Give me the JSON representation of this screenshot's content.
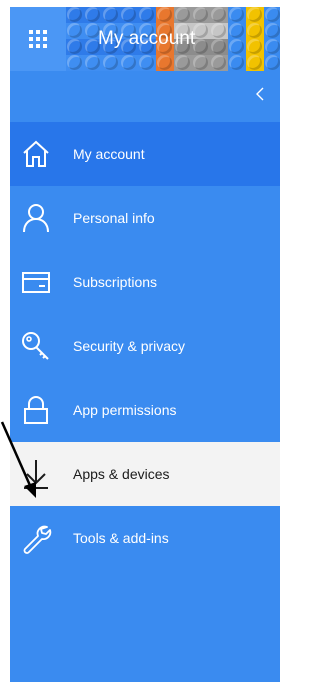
{
  "header": {
    "title": "My account",
    "app_launcher_icon": "waffle-grid-icon"
  },
  "sidebar": {
    "collapse_icon": "chevron-left-icon",
    "items": [
      {
        "label": "My account",
        "icon": "home-icon",
        "state": "current"
      },
      {
        "label": "Personal info",
        "icon": "person-icon",
        "state": "default"
      },
      {
        "label": "Subscriptions",
        "icon": "card-icon",
        "state": "default"
      },
      {
        "label": "Security & privacy",
        "icon": "key-icon",
        "state": "default"
      },
      {
        "label": "App permissions",
        "icon": "lock-icon",
        "state": "default"
      },
      {
        "label": "Apps & devices",
        "icon": "download-icon",
        "state": "selected"
      },
      {
        "label": "Tools & add-ins",
        "icon": "wrench-icon",
        "state": "default"
      }
    ]
  },
  "colors": {
    "sidebar_bg": "#3a8bf0",
    "current_item_bg": "#2876ea",
    "selected_item_bg": "#f3f3f3",
    "text_on_blue": "#ffffff",
    "text_on_selected": "#1b1b1b"
  }
}
